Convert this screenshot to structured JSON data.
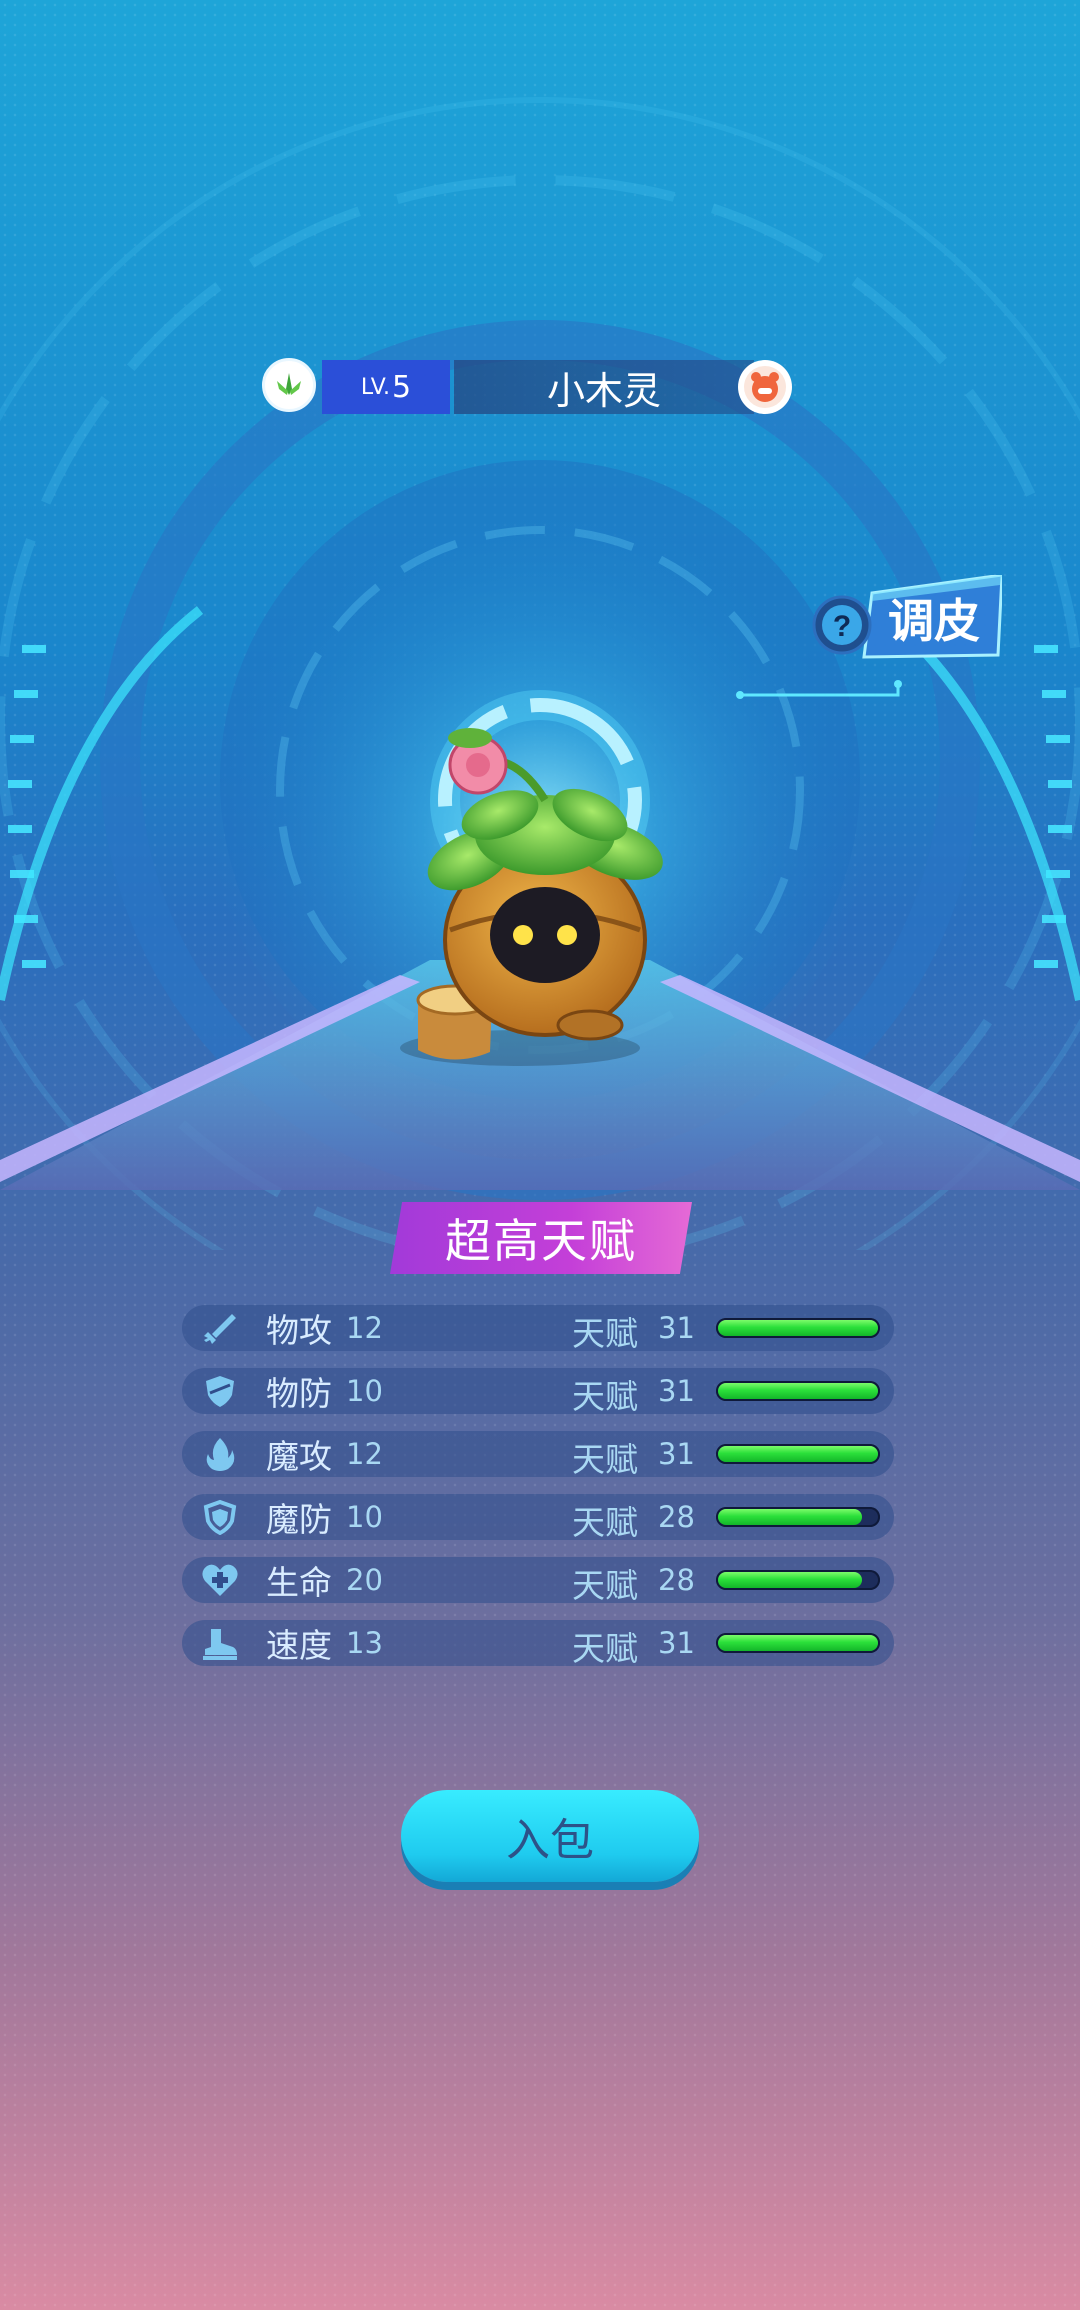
{
  "pet": {
    "level_prefix": "LV.",
    "level": "5",
    "name": "小木灵"
  },
  "tiaopi": {
    "question": "?",
    "label": "调皮"
  },
  "talent_banner": "超高天赋",
  "stats": [
    {
      "label": "物攻",
      "value": "12",
      "talent_label": "天赋",
      "talent": "31",
      "max_talent": 31,
      "icon": "sword-icon"
    },
    {
      "label": "物防",
      "value": "10",
      "talent_label": "天赋",
      "talent": "31",
      "max_talent": 31,
      "icon": "shield-icon"
    },
    {
      "label": "魔攻",
      "value": "12",
      "talent_label": "天赋",
      "talent": "31",
      "max_talent": 31,
      "icon": "flame-icon"
    },
    {
      "label": "魔防",
      "value": "10",
      "talent_label": "天赋",
      "talent": "28",
      "max_talent": 31,
      "icon": "magic-shield-icon"
    },
    {
      "label": "生命",
      "value": "20",
      "talent_label": "天赋",
      "talent": "28",
      "max_talent": 31,
      "icon": "heart-plus-icon"
    },
    {
      "label": "速度",
      "value": "13",
      "talent_label": "天赋",
      "talent": "31",
      "max_talent": 31,
      "icon": "boot-icon"
    }
  ],
  "pack_button": "入包",
  "colors": {
    "level_bg": "#2b4fd8",
    "talent_banner": "#b43fd8",
    "bar_fill": "#2be03a",
    "button": "#2cdcf7"
  }
}
